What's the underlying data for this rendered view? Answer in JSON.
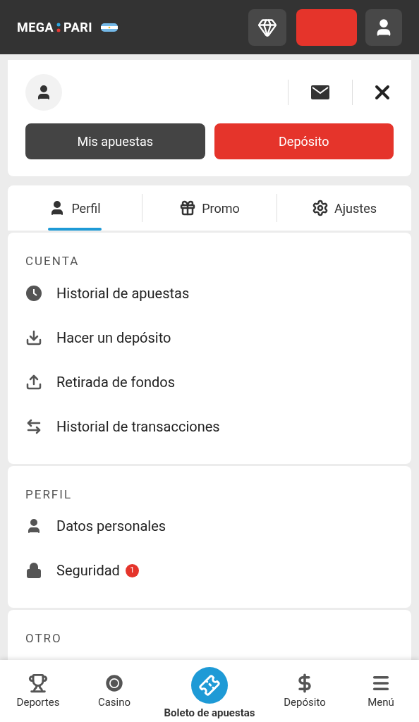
{
  "header": {
    "logo": {
      "left": "MEGA",
      "right": "PARI"
    }
  },
  "account_card": {
    "buttons": [
      {
        "label": "Mis apuestas",
        "kind": "secondary"
      },
      {
        "label": "Depósito",
        "kind": "primary"
      }
    ]
  },
  "tabs": [
    {
      "label": "Perfil",
      "selected": true
    },
    {
      "label": "Promo",
      "selected": false
    },
    {
      "label": "Ajustes",
      "selected": false
    }
  ],
  "sections": [
    {
      "title": "CUENTA",
      "items": [
        {
          "label": "Historial de apuestas"
        },
        {
          "label": "Hacer un depósito"
        },
        {
          "label": "Retirada de fondos"
        },
        {
          "label": "Historial de transacciones"
        }
      ]
    },
    {
      "title": "PERFIL",
      "items": [
        {
          "label": "Datos personales"
        },
        {
          "label": "Seguridad",
          "badge": "1"
        }
      ]
    },
    {
      "title": "OTRO"
    }
  ],
  "bottom_nav": [
    {
      "label": "Deportes",
      "selected": false
    },
    {
      "label": "Casino",
      "selected": false
    },
    {
      "label": "Boleto de apuestas",
      "selected": true
    },
    {
      "label": "Depósito",
      "selected": false
    },
    {
      "label": "Menú",
      "selected": false
    }
  ]
}
